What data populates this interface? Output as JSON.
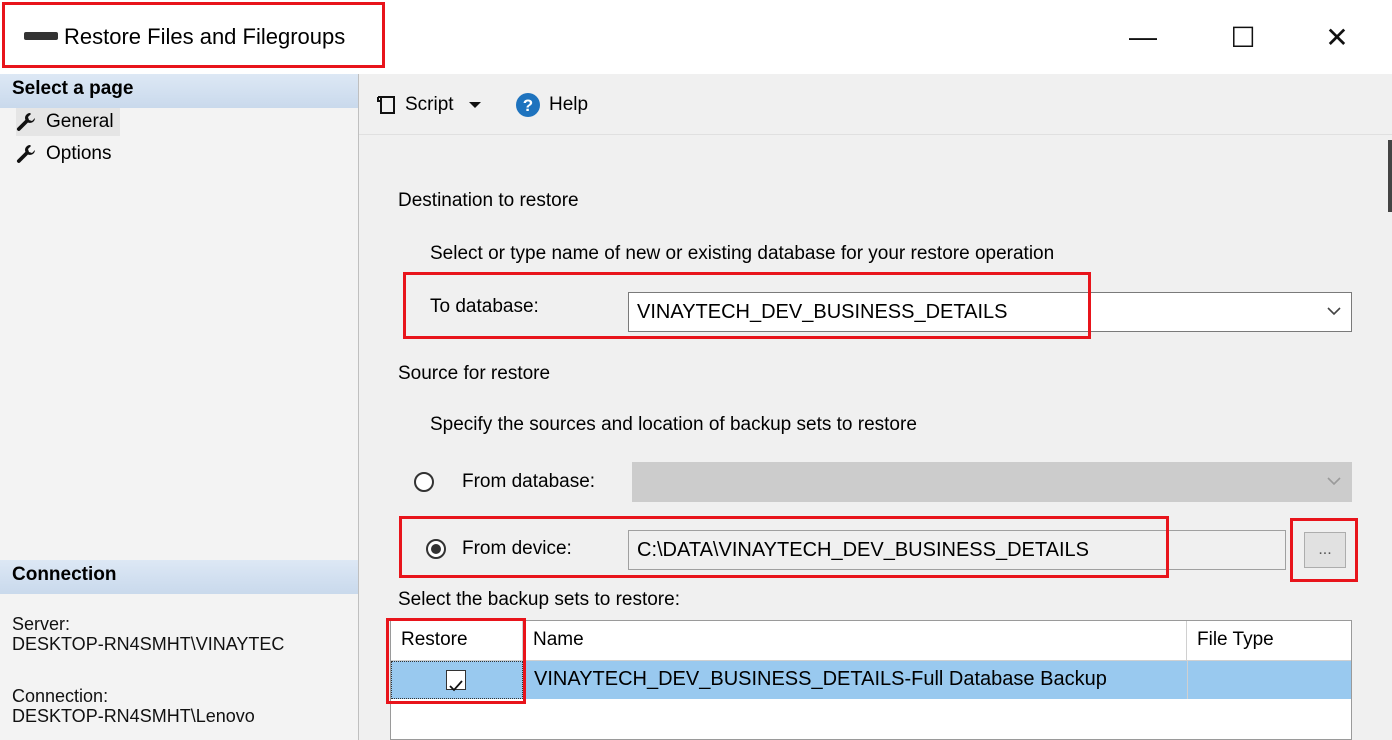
{
  "window": {
    "title": "Restore Files and Filegroups",
    "minimize_glyph": "—",
    "maximize_glyph": "☐",
    "close_glyph": "✕"
  },
  "left_pane": {
    "header": "Select a page",
    "pages": [
      {
        "label": "General",
        "icon": "wrench-icon"
      },
      {
        "label": "Options",
        "icon": "wrench-icon"
      }
    ],
    "connection_header": "Connection",
    "server_label": "Server:",
    "server_value": "DESKTOP-RN4SMHT\\VINAYTEC",
    "connection_label": "Connection:",
    "connection_value": "DESKTOP-RN4SMHT\\Lenovo"
  },
  "toolbar": {
    "script_label": "Script",
    "help_label": "Help"
  },
  "destination": {
    "section_title": "Destination to restore",
    "instructions": "Select or type name of new or existing database for your restore operation",
    "to_database_label": "To database:",
    "to_database_value": "VINAYTECH_DEV_BUSINESS_DETAILS"
  },
  "source": {
    "section_title": "Source for restore",
    "instructions": "Specify the sources and location of backup sets to restore",
    "from_database_label": "From database:",
    "from_database_value": "",
    "from_device_label": "From device:",
    "from_device_value": "C:\\DATA\\VINAYTECH_DEV_BUSINESS_DETAILS",
    "browse_label": "...",
    "selected": "from_device"
  },
  "backup_sets": {
    "title": "Select the backup sets to restore:",
    "columns": [
      "Restore",
      "Name",
      "File Type"
    ],
    "rows": [
      {
        "restore": true,
        "name": "VINAYTECH_DEV_BUSINESS_DETAILS-Full Database Backup",
        "file_type": ""
      }
    ]
  },
  "colors": {
    "highlight_red": "#e8141b",
    "row_selection": "#99c9ef",
    "help_icon_blue": "#1e73be"
  }
}
